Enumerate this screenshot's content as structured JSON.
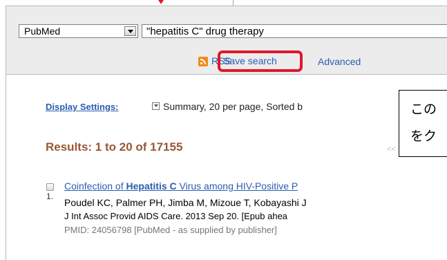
{
  "search": {
    "database": "PubMed",
    "term": "\"hepatitis C\" drug therapy",
    "rss_label": "RSS",
    "save_search_label": "Save search",
    "advanced_label": "Advanced"
  },
  "display": {
    "label": "Display Settings:",
    "value": "Summary, 20 per page, Sorted b"
  },
  "results": {
    "summary": "Results: 1 to 20 of 17155",
    "pager": "<<"
  },
  "items": [
    {
      "number": "1.",
      "title_pre": "Coinfection of ",
      "title_bold": "Hepatitis C",
      "title_post": " Virus among HIV-Positive P",
      "authors": "Poudel KC, Palmer PH, Jimba M, Mizoue T, Kobayashi J",
      "journal": "J Int Assoc Provid AIDS Care. 2013 Sep 20. [Epub ahea",
      "pmid": "PMID: 24056798 [PubMed - as supplied by publisher]"
    }
  ],
  "callout": {
    "line1": "この",
    "line2": "をク"
  },
  "colors": {
    "highlight": "#e0182b",
    "link": "#2a5db0",
    "results_heading": "#985735"
  },
  "icons": [
    "arrow-down-icon",
    "dropdown-icon",
    "rss-icon",
    "display-settings-toggle-icon",
    "checkbox-icon"
  ]
}
